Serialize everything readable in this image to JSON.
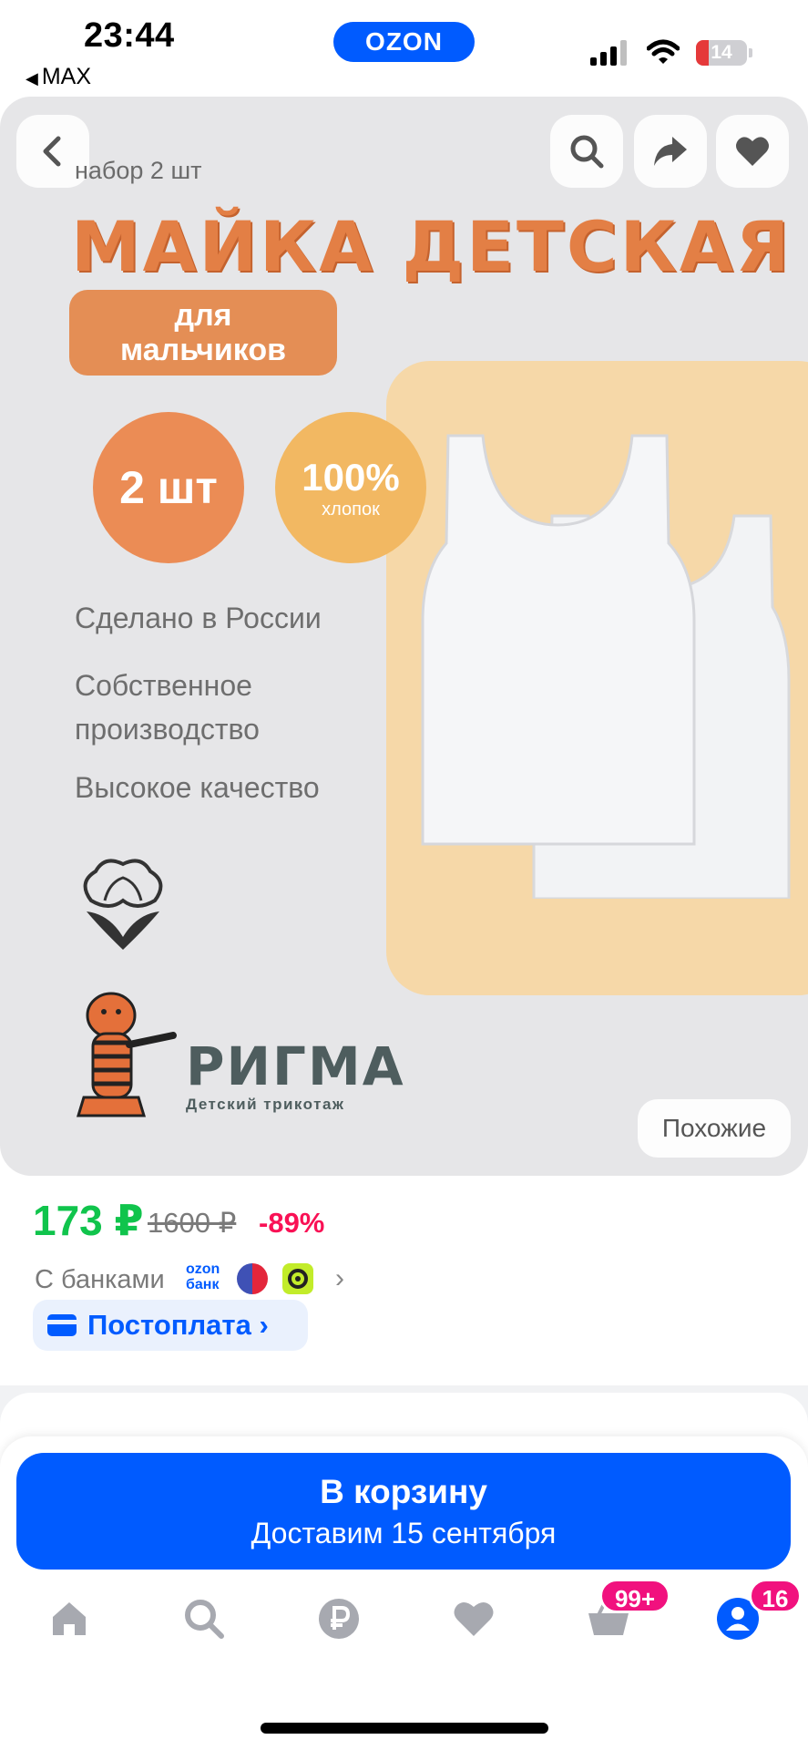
{
  "status_bar": {
    "time": "23:44",
    "back_app": "MAX",
    "center_app": "OZON",
    "battery": "14",
    "icons": [
      "cellular-signal-icon",
      "wifi-icon",
      "battery-icon"
    ]
  },
  "product_image": {
    "subtitle": "набор 2 шт",
    "title": "МАЙКА ДЕТСКАЯ",
    "for_boys": [
      "для",
      "мальчиков"
    ],
    "count_badge": "2 шт",
    "cotton_percent": "100%",
    "cotton_label": "хлопок",
    "features": [
      "Сделано в России",
      "Собственное",
      "производство",
      "Высокое качество"
    ],
    "brand_name": "РИГМА",
    "brand_tagline": "Детский трикотаж",
    "similar_button": "Похожие",
    "colors": {
      "title": "#e37f45",
      "circle_count": "#eb8c55",
      "circle_cotton": "#f2b862",
      "background": "#e6e6e8"
    }
  },
  "price": {
    "current": "173 ₽",
    "old": "1600 ₽",
    "discount": "-89%",
    "banks_label": "С банками",
    "ozon_bank": [
      "ozon",
      "банк"
    ],
    "postpay_label": "Постоплата",
    "colors": {
      "current": "#10c44c",
      "discount": "#f91155",
      "accent": "#005bff"
    }
  },
  "cart": {
    "button_label": "В корзину",
    "delivery": "Доставим 15 сентября"
  },
  "tab_bar": {
    "items": [
      {
        "name": "home",
        "icon": "home-icon"
      },
      {
        "name": "search",
        "icon": "search-icon"
      },
      {
        "name": "finance",
        "icon": "ruble-icon"
      },
      {
        "name": "favorites",
        "icon": "heart-icon"
      },
      {
        "name": "cart",
        "icon": "basket-icon",
        "badge": "99+"
      },
      {
        "name": "profile",
        "icon": "profile-icon",
        "badge": "16"
      }
    ]
  }
}
